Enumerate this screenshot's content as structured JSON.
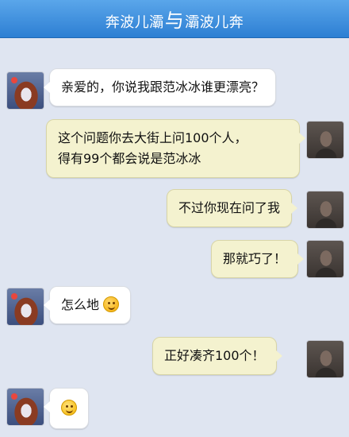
{
  "header": {
    "left_name": "奔波儿灞",
    "separator": "与",
    "right_name": "灞波儿奔"
  },
  "messages": [
    {
      "side": "left",
      "avatar_icon": "girl-avatar-icon",
      "text": "亲爱的，你说我跟范冰冰谁更漂亮？"
    },
    {
      "side": "right",
      "avatar_icon": "man-avatar-icon",
      "line1": "这个问题你去大街上问100个人，",
      "line2": "得有99个都会说是范冰冰"
    },
    {
      "side": "right",
      "avatar_icon": "man-avatar-icon",
      "text": "不过你现在问了我"
    },
    {
      "side": "right",
      "avatar_icon": "man-avatar-icon",
      "text": "那就巧了！"
    },
    {
      "side": "left",
      "avatar_icon": "girl-avatar-icon",
      "text": "怎么地",
      "emoji": "blush-emoji-icon"
    },
    {
      "side": "right",
      "avatar_icon": "man-avatar-icon",
      "text": "正好凑齐100个！"
    },
    {
      "side": "left",
      "avatar_icon": "girl-avatar-icon",
      "emoji": "smile-emoji-icon"
    }
  ]
}
